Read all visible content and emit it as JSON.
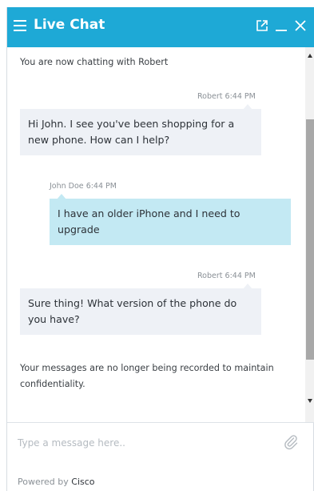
{
  "header": {
    "title": "Live Chat",
    "icons": [
      "menu-icon",
      "popout-icon",
      "minimize-icon",
      "close-icon"
    ],
    "background_color": "#1ea9d6"
  },
  "messages": {
    "status_start": "You are now chatting with Robert",
    "items": [
      {
        "sender": "Robert",
        "time": "6:44 PM",
        "text": "Hi John. I see you've been shopping for a new phone. How can I help?"
      },
      {
        "sender": "John Doe",
        "time": "6:44 PM",
        "text": "I have an older iPhone and I need to upgrade"
      },
      {
        "sender": "Robert",
        "time": "6:44 PM",
        "text": "Sure thing! What version of the phone do you have?"
      }
    ],
    "status_end": "Your messages are no longer being recorded to maintain confidentiality."
  },
  "composer": {
    "placeholder": "Type a message here..",
    "value": ""
  },
  "footer": {
    "prefix": "Powered by",
    "brand": "Cisco"
  },
  "colors": {
    "agent_bubble": "#eef1f6",
    "user_bubble": "#c3e9f3"
  }
}
